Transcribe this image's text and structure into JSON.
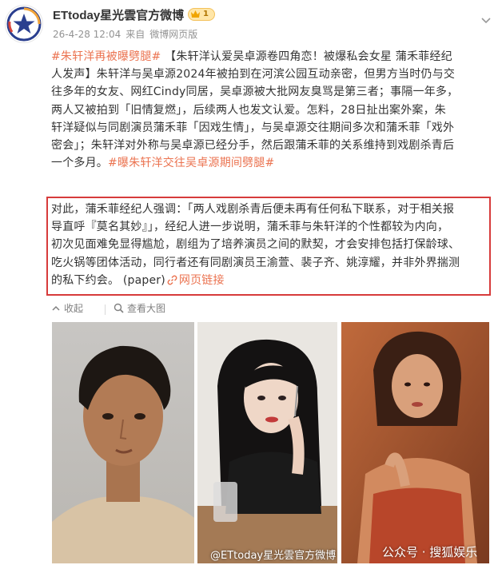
{
  "author": {
    "name": "ETtoday星光雲官方微博",
    "vip_level": "1",
    "avatar_icon": "star-logo-icon"
  },
  "meta": {
    "date": "26-4-28 12:04",
    "source_prefix": "来自",
    "source": "微博网页版"
  },
  "post": {
    "tag1": "#朱轩洋再被曝劈腿#",
    "line1_rest": "【朱轩洋认爱吴卓源卷四角恋！被爆私会女星 蒲禾菲经纪",
    "line2": "人发声】朱轩洋与吴卓源2024年被拍到在河滨公园互动亲密，但男方当时仍与交",
    "line3": "往多年的女友、网红Cindy同居，吴卓源被大批网友臭骂是第三者；事隔一年多，",
    "line4": "两人又被拍到「旧情复燃」，后续两人也发文认爱。怎料，28日扯出案外案，朱",
    "line5": "轩洋疑似与同剧演员蒲禾菲「因戏生情」，与吴卓源交往期间多次和蒲禾菲「戏外",
    "line6": "密会」；朱轩洋对外称与吴卓源已经分手，然后跟蒲禾菲的关系维持到戏剧杀青后",
    "line7_start": "一个多月。",
    "tag2": "#曝朱轩洋交往吴卓源期间劈腿#"
  },
  "quote": {
    "line1": "对此，蒲禾菲经纪人强调：「两人戏剧杀青后便未再有任何私下联系，对于相关报",
    "line2": "导直呼『莫名其妙』」，经纪人进一步说明，蒲禾菲与朱轩洋的个性都较为内向，",
    "line3": "初次见面难免显得尴尬，剧组为了培养演员之间的默契，才会安排包括打保龄球、",
    "line4": "吃火锅等团体活动，同行者还有同剧演员王渝萱、裴子齐、姚淳耀，并非外界揣测",
    "line5_start": "的私下约会。 (paper)",
    "link_label": "网页链接"
  },
  "actions": {
    "collect_label": "收起",
    "view_large_label": "查看大图"
  },
  "watermarks": {
    "weibo": "@ETtoday星光雲官方微博",
    "wechat": "公众号 · 搜狐娱乐"
  },
  "colors": {
    "accent": "#eb7350",
    "highlight_border": "#d73b3b",
    "brand_blue": "#2a3f8f"
  }
}
